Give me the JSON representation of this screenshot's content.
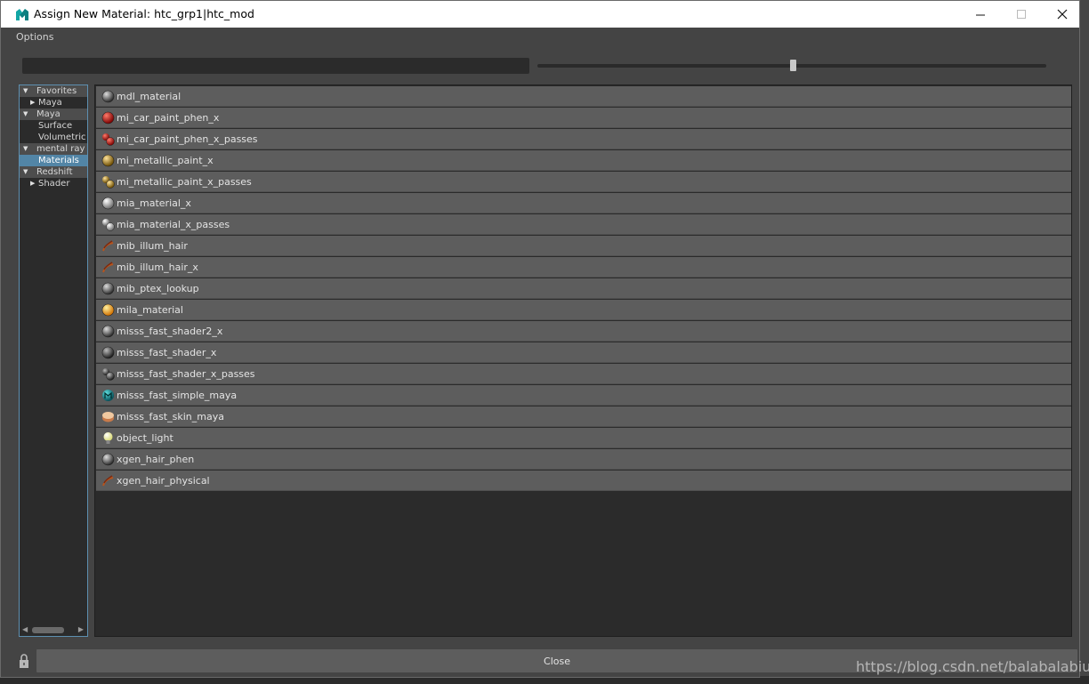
{
  "window": {
    "title": "Assign New Material: htc_grp1|htc_mod",
    "close_label": "Close"
  },
  "menu": {
    "options": "Options"
  },
  "tree": [
    {
      "label": "Favorites",
      "header": true,
      "arrow": "down",
      "indent": 0
    },
    {
      "label": "Maya",
      "header": false,
      "arrow": "right",
      "indent": 1
    },
    {
      "label": "Maya",
      "header": true,
      "arrow": "down",
      "indent": 0
    },
    {
      "label": "Surface",
      "header": false,
      "arrow": "",
      "indent": 1
    },
    {
      "label": "Volumetric",
      "header": false,
      "arrow": "",
      "indent": 1
    },
    {
      "label": "mental ray",
      "header": true,
      "arrow": "down",
      "indent": 0
    },
    {
      "label": "Materials",
      "header": false,
      "arrow": "",
      "indent": 1,
      "selected": true
    },
    {
      "label": "Redshift",
      "header": true,
      "arrow": "down",
      "indent": 0
    },
    {
      "label": "Shader",
      "header": false,
      "arrow": "right",
      "indent": 1
    }
  ],
  "materials": [
    {
      "label": "mdl_material",
      "icon": "gray-sphere-icon"
    },
    {
      "label": "mi_car_paint_phen_x",
      "icon": "red-sphere-icon"
    },
    {
      "label": "mi_car_paint_phen_x_passes",
      "icon": "red-sphere-passes-icon"
    },
    {
      "label": "mi_metallic_paint_x",
      "icon": "gold-sphere-icon"
    },
    {
      "label": "mi_metallic_paint_x_passes",
      "icon": "gold-sphere-passes-icon"
    },
    {
      "label": "mia_material_x",
      "icon": "silver-sphere-icon"
    },
    {
      "label": "mia_material_x_passes",
      "icon": "silver-sphere-passes-icon"
    },
    {
      "label": "mib_illum_hair",
      "icon": "hair-icon"
    },
    {
      "label": "mib_illum_hair_x",
      "icon": "hair-icon"
    },
    {
      "label": "mib_ptex_lookup",
      "icon": "gray-sphere-icon"
    },
    {
      "label": "mila_material",
      "icon": "orange-sphere-icon"
    },
    {
      "label": "misss_fast_shader2_x",
      "icon": "gray-sphere-icon"
    },
    {
      "label": "misss_fast_shader_x",
      "icon": "dark-sphere-icon"
    },
    {
      "label": "misss_fast_shader_x_passes",
      "icon": "dark-sphere-passes-icon"
    },
    {
      "label": "misss_fast_simple_maya",
      "icon": "teal-maya-icon"
    },
    {
      "label": "misss_fast_skin_maya",
      "icon": "skin-icon"
    },
    {
      "label": "object_light",
      "icon": "light-bulb-icon"
    },
    {
      "label": "xgen_hair_phen",
      "icon": "gray-sphere-icon"
    },
    {
      "label": "xgen_hair_physical",
      "icon": "hair-icon"
    }
  ],
  "slider": {
    "value": 0.5
  },
  "watermark": "https://blog.csdn.net/balabalabiubiu"
}
